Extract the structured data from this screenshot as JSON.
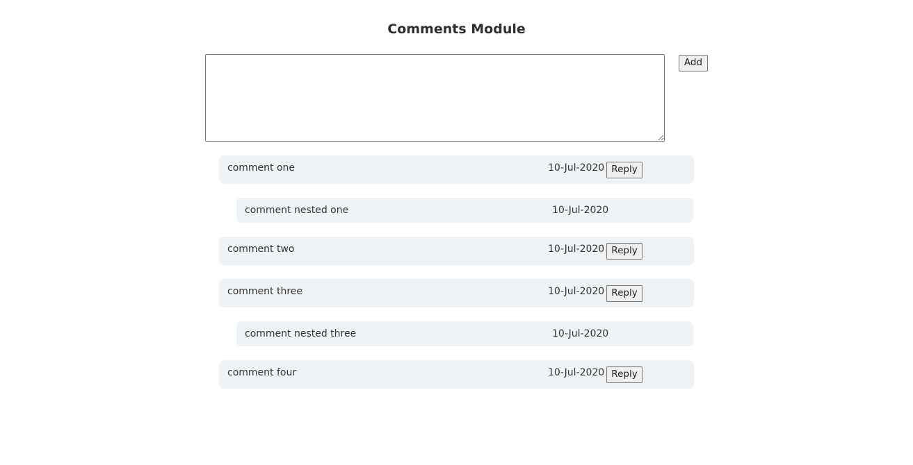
{
  "page": {
    "title": "Comments Module"
  },
  "composer": {
    "value": "",
    "add_label": "Add"
  },
  "comments": [
    {
      "text": "comment one",
      "date": "10-Jul-2020",
      "reply_label": "Reply"
    },
    {
      "text": "comment nested one",
      "date": "10-Jul-2020"
    },
    {
      "text": "comment two",
      "date": "10-Jul-2020",
      "reply_label": "Reply"
    },
    {
      "text": "comment three",
      "date": "10-Jul-2020",
      "reply_label": "Reply"
    },
    {
      "text": "comment nested three",
      "date": "10-Jul-2020"
    },
    {
      "text": "comment four",
      "date": "10-Jul-2020",
      "reply_label": "Reply"
    }
  ],
  "colors": {
    "comment_background": "#f0f3f6",
    "text": "#333333",
    "button_background": "#efefef"
  }
}
